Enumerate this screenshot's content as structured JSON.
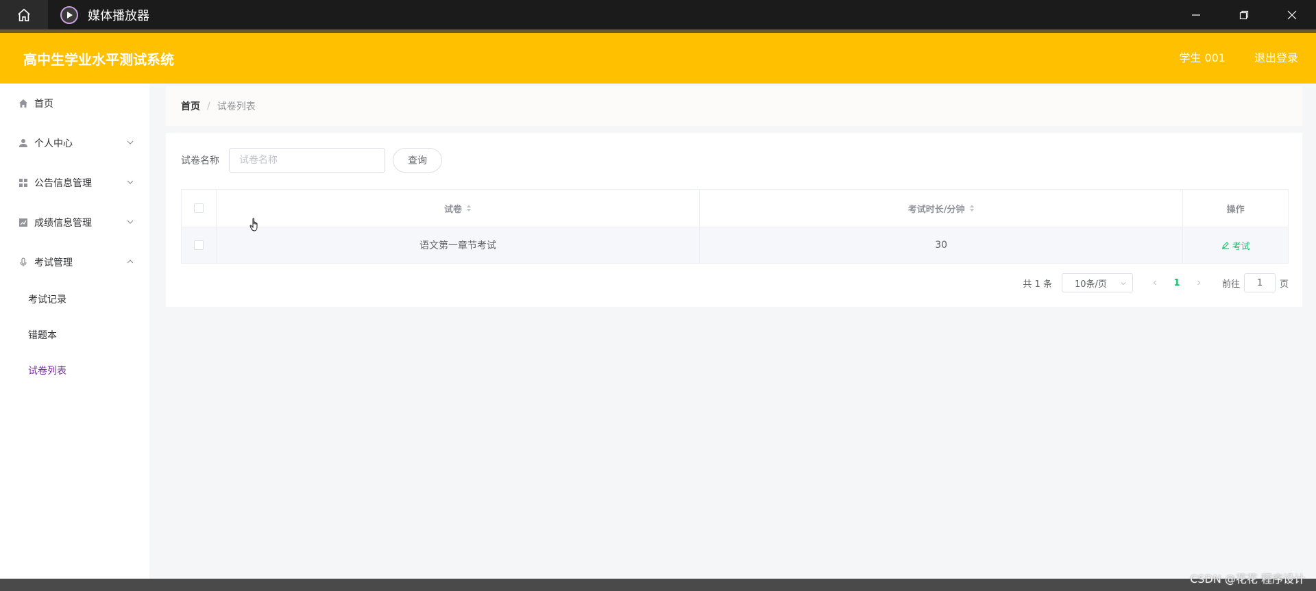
{
  "window": {
    "title": "媒体播放器"
  },
  "header": {
    "system_title": "高中生学业水平测试系统",
    "user": "学生 001",
    "logout": "退出登录"
  },
  "sidebar": {
    "items": [
      {
        "label": "首页",
        "icon": "home-icon"
      },
      {
        "label": "个人中心",
        "icon": "user-icon",
        "expanded": false
      },
      {
        "label": "公告信息管理",
        "icon": "grid-icon",
        "expanded": false
      },
      {
        "label": "成绩信息管理",
        "icon": "chart-icon",
        "expanded": false
      },
      {
        "label": "考试管理",
        "icon": "microphone-icon",
        "expanded": true
      }
    ],
    "sub_items": [
      {
        "label": "考试记录"
      },
      {
        "label": "错题本"
      },
      {
        "label": "试卷列表",
        "active": true
      }
    ]
  },
  "breadcrumb": {
    "home": "首页",
    "separator": "/",
    "current": "试卷列表"
  },
  "search": {
    "label": "试卷名称",
    "placeholder": "试卷名称",
    "value": "",
    "button": "查询"
  },
  "table": {
    "headers": [
      "试卷",
      "考试时长/分钟",
      "操作"
    ],
    "rows": [
      {
        "name": "语文第一章节考试",
        "duration": "30",
        "action": "考试"
      }
    ]
  },
  "pagination": {
    "total": "共 1 条",
    "page_size": "10条/页",
    "current_page": "1",
    "goto_label": "前往",
    "goto_value": "1",
    "page_suffix": "页"
  },
  "watermark": "CSDN @花花 程序设计",
  "colors": {
    "header_bg": "#ffc000",
    "active_menu": "#7b2ba8",
    "action_green": "#19be6b"
  }
}
